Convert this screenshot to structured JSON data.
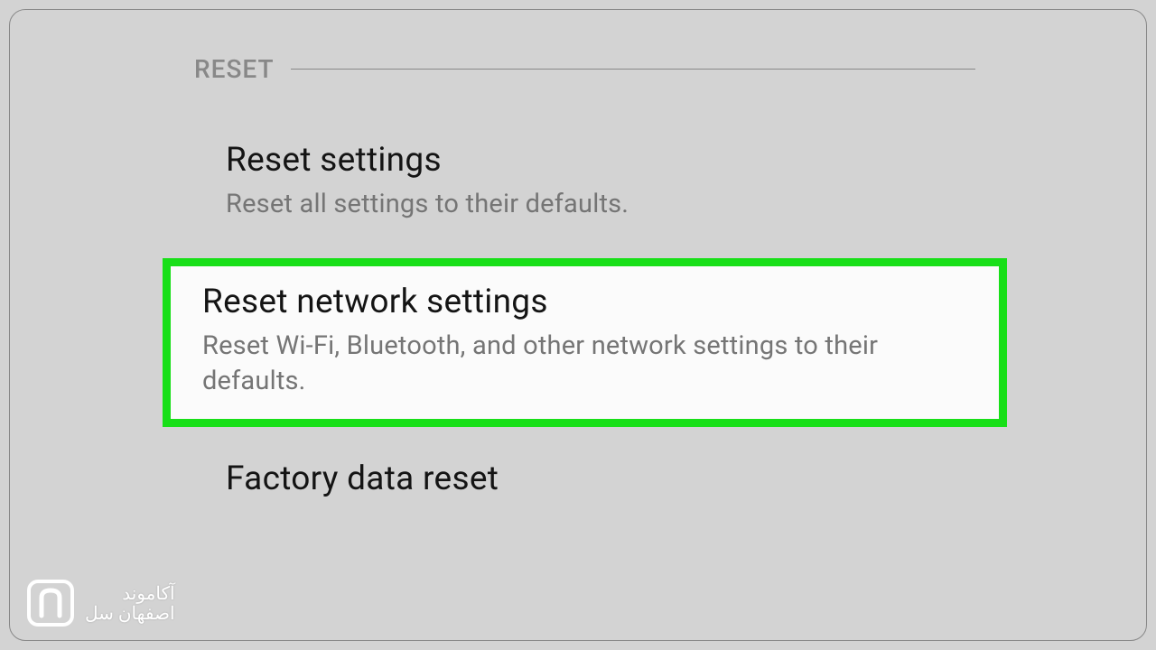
{
  "section": {
    "header": "RESET"
  },
  "items": {
    "reset_settings": {
      "title": "Reset settings",
      "desc": "Reset all settings to their defaults."
    },
    "reset_network": {
      "title": "Reset network settings",
      "desc": "Reset Wi-Fi, Bluetooth, and other network settings to their defaults."
    },
    "factory_reset": {
      "title": "Factory data reset"
    }
  },
  "watermark": {
    "line1": "آکاموند",
    "line2": "اصفهان سل"
  },
  "colors": {
    "highlight": "#18df18",
    "background": "#d3d3d3"
  }
}
